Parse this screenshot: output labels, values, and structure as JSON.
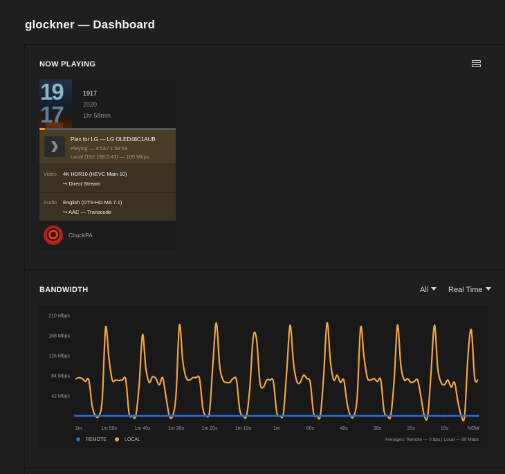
{
  "page": {
    "title": "glockner — Dashboard"
  },
  "now_playing": {
    "section_title": "NOW PLAYING",
    "icon": "list-view-icon",
    "card": {
      "poster": {
        "line1": "19",
        "line2": "17"
      },
      "title": "1917",
      "year": "2020",
      "duration": "1hr 58min",
      "progress_fraction": 0.041,
      "player": "Plex for LG — LG OLED48C1AUB",
      "state": "Playing — 4:53 / 1:58:59",
      "network": "Local (192.168.0.43) — 105 Mbps",
      "video": {
        "label": "Video",
        "value": "4K HDR10 (HEVC Main 10)",
        "decision": "↪    Direct Stream"
      },
      "audio": {
        "label": "Audio",
        "value": "English (DTS-HD MA 7.1)",
        "decision": "↪    AAC — Transcode"
      },
      "user": "ChuckPA"
    }
  },
  "bandwidth": {
    "section_title": "BANDWIDTH",
    "filter_label": "All",
    "range_label": "Real Time",
    "averages": "Averages: Remote — 0 bps | Local — 80 Mbps",
    "legend": {
      "remote": "REMOTE",
      "local": "LOCAL"
    }
  },
  "colors": {
    "accent": "#e5a00d",
    "local": "#f5a53c",
    "remote": "#1e6fd9",
    "background": "#1f1f1f"
  },
  "chart_data": {
    "type": "line",
    "xlabel": "",
    "ylabel": "",
    "ylim": [
      0,
      210
    ],
    "yticks": [
      42,
      84,
      126,
      168,
      210
    ],
    "ytick_labels": [
      "42 Mbps",
      "84 Mbps",
      "126 Mbps",
      "168 Mbps",
      "210 Mbps"
    ],
    "xtick_labels": [
      "2m",
      "1m 50s",
      "1m 40s",
      "1m 30s",
      "1m 20s",
      "1m 10s",
      "1m",
      "50s",
      "40s",
      "30s",
      "20s",
      "10s",
      "NOW"
    ],
    "grid": false,
    "legend_placement": "bottom-left",
    "series": [
      {
        "name": "REMOTE",
        "color": "#1e6fd9",
        "values": [
          0,
          0,
          0,
          0,
          0,
          0,
          0,
          0,
          0,
          0,
          0,
          0,
          0
        ]
      },
      {
        "name": "LOCAL",
        "color": "#f5a53c",
        "values": [
          77,
          80,
          78,
          72,
          75,
          20,
          0,
          0,
          35,
          185,
          120,
          75,
          75,
          74,
          75,
          76,
          5,
          0,
          0,
          65,
          170,
          100,
          70,
          82,
          78,
          65,
          80,
          40,
          0,
          0,
          45,
          190,
          115,
          80,
          75,
          80,
          80,
          78,
          15,
          0,
          10,
          110,
          195,
          105,
          75,
          70,
          70,
          78,
          75,
          12,
          0,
          0,
          60,
          165,
          160,
          70,
          60,
          75,
          75,
          72,
          8,
          0,
          5,
          95,
          190,
          110,
          72,
          70,
          85,
          78,
          70,
          5,
          0,
          0,
          85,
          195,
          115,
          75,
          85,
          70,
          75,
          25,
          0,
          0,
          40,
          185,
          125,
          80,
          75,
          78,
          72,
          75,
          10,
          0,
          0,
          75,
          190,
          105,
          75,
          78,
          70,
          72,
          75,
          40,
          0,
          0,
          90,
          190,
          100,
          70,
          65,
          75,
          60,
          70,
          30,
          0,
          0,
          125,
          180,
          80,
          75
        ]
      }
    ]
  }
}
